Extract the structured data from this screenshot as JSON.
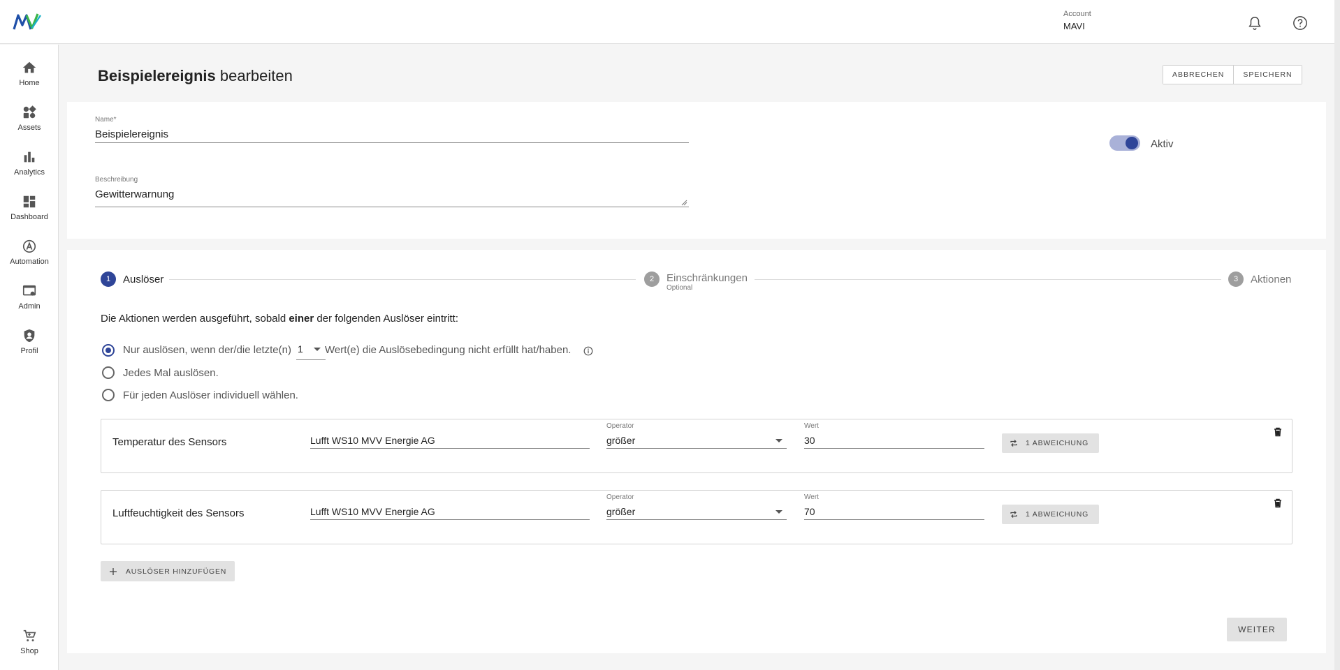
{
  "header": {
    "account_label": "Account",
    "account_value": "MAVI",
    "icons": [
      "bell-icon",
      "help-icon"
    ]
  },
  "sidebar": {
    "items": [
      {
        "label": "Home",
        "icon": "home-icon"
      },
      {
        "label": "Assets",
        "icon": "assets-icon"
      },
      {
        "label": "Analytics",
        "icon": "analytics-icon"
      },
      {
        "label": "Dashboard",
        "icon": "dashboard-icon"
      },
      {
        "label": "Automation",
        "icon": "automation-icon"
      },
      {
        "label": "Admin",
        "icon": "admin-icon"
      },
      {
        "label": "Profil",
        "icon": "profile-icon"
      },
      {
        "label": "Shop",
        "icon": "cart-icon"
      }
    ]
  },
  "page": {
    "title_bold": "Beispielereignis",
    "title_rest": " bearbeiten",
    "cancel_label": "ABBRECHEN",
    "save_label": "SPEICHERN"
  },
  "form": {
    "name_label": "Name*",
    "name_value": "Beispielereignis",
    "description_label": "Beschreibung",
    "description_value": "Gewitterwarnung",
    "active_label": "Aktiv",
    "active": true
  },
  "colors": {
    "primary": "#2f4598",
    "toggle_track": "#a9b1d8",
    "step_inactive": "#9e9e9e"
  },
  "stepper": {
    "steps": [
      {
        "number": "1",
        "label": "Auslöser",
        "sublabel": "",
        "active": true
      },
      {
        "number": "2",
        "label": "Einschränkungen",
        "sublabel": "Optional",
        "active": false
      },
      {
        "number": "3",
        "label": "Aktionen",
        "sublabel": "",
        "active": false
      }
    ]
  },
  "triggers": {
    "lead_pre": "Die Aktionen werden ausgeführt, sobald ",
    "lead_bold": "einer",
    "lead_post": " der folgenden Auslöser eintritt:",
    "options": [
      {
        "pre": "Nur auslösen, wenn der/die letzte(n)",
        "post": "Wert(e) die Auslösebedingung nicht erfüllt hat/haben.",
        "checked": true
      },
      {
        "pre": "Jedes Mal auslösen.",
        "checked": false
      },
      {
        "pre": "Für jeden Auslöser individuell wählen.",
        "checked": false
      }
    ],
    "count_value": "1",
    "operator_label": "Operator",
    "value_label": "Wert",
    "rows": [
      {
        "name": "Temperatur des Sensors",
        "sensor": "Lufft WS10 MVV Energie AG",
        "operator": "größer",
        "value": "30",
        "deviation": "1 ABWEICHUNG"
      },
      {
        "name": "Luftfeuchtigkeit des Sensors",
        "sensor": "Lufft WS10 MVV Energie AG",
        "operator": "größer",
        "value": "70",
        "deviation": "1 ABWEICHUNG"
      }
    ],
    "add_label": "AUSLÖSER HINZUFÜGEN",
    "next_label": "WEITER"
  }
}
